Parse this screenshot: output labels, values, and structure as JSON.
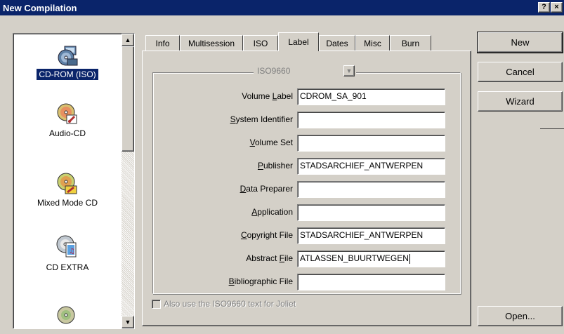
{
  "window": {
    "title": "New Compilation",
    "help_glyph": "?",
    "close_glyph": "×"
  },
  "compilation_types": [
    {
      "label": "CD-ROM (ISO)",
      "icon": "cdrom-iso-icon",
      "selected": true
    },
    {
      "label": "Audio-CD",
      "icon": "audio-cd-icon",
      "selected": false
    },
    {
      "label": "Mixed Mode CD",
      "icon": "mixed-mode-cd-icon",
      "selected": false
    },
    {
      "label": "CD EXTRA",
      "icon": "cd-extra-icon",
      "selected": false
    },
    {
      "label": "",
      "icon": "cd-partial-icon",
      "selected": false
    }
  ],
  "tabs": [
    {
      "label": "Info"
    },
    {
      "label": "Multisession"
    },
    {
      "label": "ISO"
    },
    {
      "label": "Label",
      "active": true
    },
    {
      "label": "Dates"
    },
    {
      "label": "Misc"
    },
    {
      "label": "Burn"
    }
  ],
  "label_tab": {
    "format_combo": {
      "value": "ISO9660",
      "disabled": true
    },
    "fields": [
      {
        "label": "Volume Label",
        "accel": "L",
        "value": "CDROM_SA_901"
      },
      {
        "label": "System Identifier",
        "accel": "S",
        "value": ""
      },
      {
        "label": "Volume Set",
        "accel": "V",
        "value": ""
      },
      {
        "label": "Publisher",
        "accel": "P",
        "value": "STADSARCHIEF_ANTWERPEN"
      },
      {
        "label": "Data Preparer",
        "accel": "D",
        "value": ""
      },
      {
        "label": "Application",
        "accel": "A",
        "value": ""
      },
      {
        "label": "Copyright File",
        "accel": "C",
        "value": "STADSARCHIEF_ANTWERPEN"
      },
      {
        "label": "Abstract File",
        "accel": "F",
        "value": "ATLASSEN_BUURTWEGEN",
        "focused": true
      },
      {
        "label": "Bibliographic File",
        "accel": "B",
        "value": ""
      }
    ],
    "joliet_checkbox": {
      "label": "Also use the ISO9660 text for Joliet",
      "checked": false,
      "disabled": true
    }
  },
  "buttons": {
    "new": "New",
    "cancel": "Cancel",
    "wizard": "Wizard",
    "open": "Open..."
  },
  "colors": {
    "face": "#d4d0c8",
    "title_bar": "#0a246a",
    "selection": "#0a246a"
  }
}
